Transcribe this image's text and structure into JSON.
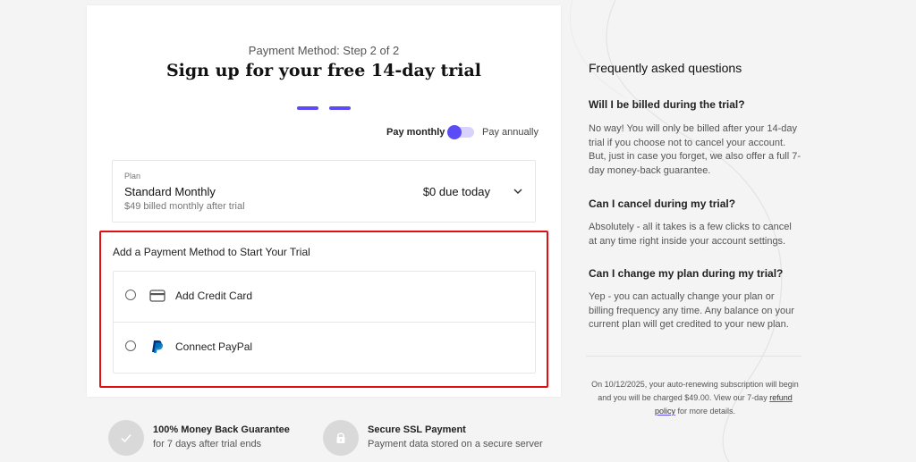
{
  "signup": {
    "step_label": "Payment Method: Step 2 of 2",
    "title": "Sign up for your free 14-day trial",
    "pay_monthly": "Pay monthly",
    "pay_annually": "Pay annually",
    "plan": {
      "label": "Plan",
      "name": "Standard Monthly",
      "sub": "$49 billed monthly after trial",
      "due": "$0 due today"
    },
    "payment": {
      "heading": "Add a Payment Method to Start Your Trial",
      "options": [
        {
          "label": "Add Credit Card",
          "icon": "credit-card-icon"
        },
        {
          "label": "Connect PayPal",
          "icon": "paypal-icon"
        }
      ]
    }
  },
  "badges": [
    {
      "title": "100% Money Back Guarantee",
      "sub": "for 7 days after trial ends",
      "icon": "checkmark-icon"
    },
    {
      "title": "Secure SSL Payment",
      "sub": "Payment data stored on a secure server",
      "icon": "lock-icon"
    }
  ],
  "faq": {
    "title": "Frequently asked questions",
    "items": [
      {
        "q": "Will I be billed during the trial?",
        "a": "No way! You will only be billed after your 14-day trial if you choose not to cancel your account. But, just in case you forget, we also offer a full 7-day money-back guarantee."
      },
      {
        "q": "Can I cancel during my trial?",
        "a": "Absolutely - all it takes is a few clicks to cancel at any time right inside your account settings."
      },
      {
        "q": "Can I change my plan during my trial?",
        "a": "Yep - you can actually change your plan or billing frequency any time. Any balance on your current plan will get credited to your new plan."
      }
    ],
    "renewal_text": "On 10/12/2025, your auto-renewing subscription will begin and you will be charged $49.00. View our 7-day",
    "refund_link": "refund policy",
    "renewal_suffix": "for more details."
  },
  "colors": {
    "accent": "#5b4cf5",
    "highlight_border": "#e01010"
  }
}
